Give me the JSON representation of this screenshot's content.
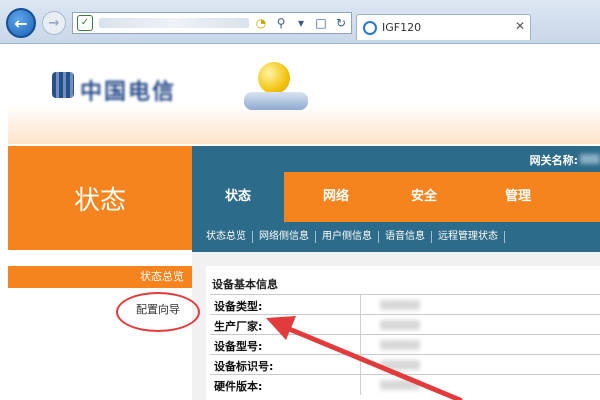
{
  "browser": {
    "tab_title": "IGF120",
    "colors": {
      "chrome_bg": "#dce6f2",
      "back_button": "#1a5fb4"
    },
    "icons": [
      "back-arrow-icon",
      "forward-arrow-icon",
      "security-shield-icon",
      "search-icon",
      "dropdown-icon",
      "refresh-icon",
      "tab-favicon-icon",
      "close-icon"
    ]
  },
  "header": {
    "logo_text": "中国电信"
  },
  "panel": {
    "title": "状态"
  },
  "gateway": {
    "label": "网关名称:"
  },
  "main_tabs": [
    {
      "label": "状态",
      "active": true
    },
    {
      "label": "网络",
      "active": false
    },
    {
      "label": "安全",
      "active": false
    },
    {
      "label": "管理",
      "active": false
    }
  ],
  "sub_nav": [
    {
      "label": "状态总览"
    },
    {
      "label": "网络侧信息"
    },
    {
      "label": "用户侧信息"
    },
    {
      "label": "语音信息"
    },
    {
      "label": "远程管理状态"
    }
  ],
  "sidebar": {
    "items": [
      {
        "label": "状态总览",
        "active": true
      },
      {
        "label": "配置向导",
        "active": false
      }
    ]
  },
  "content": {
    "section_title": "设备基本信息",
    "rows": [
      {
        "label": "设备类型:"
      },
      {
        "label": "生产厂家:"
      },
      {
        "label": "设备型号:"
      },
      {
        "label": "设备标识号:"
      },
      {
        "label": "硬件版本:"
      }
    ]
  },
  "colors": {
    "accent_orange": "#f5841f",
    "nav_teal": "#2d6b8a",
    "annotation_red": "#e23b3b"
  }
}
